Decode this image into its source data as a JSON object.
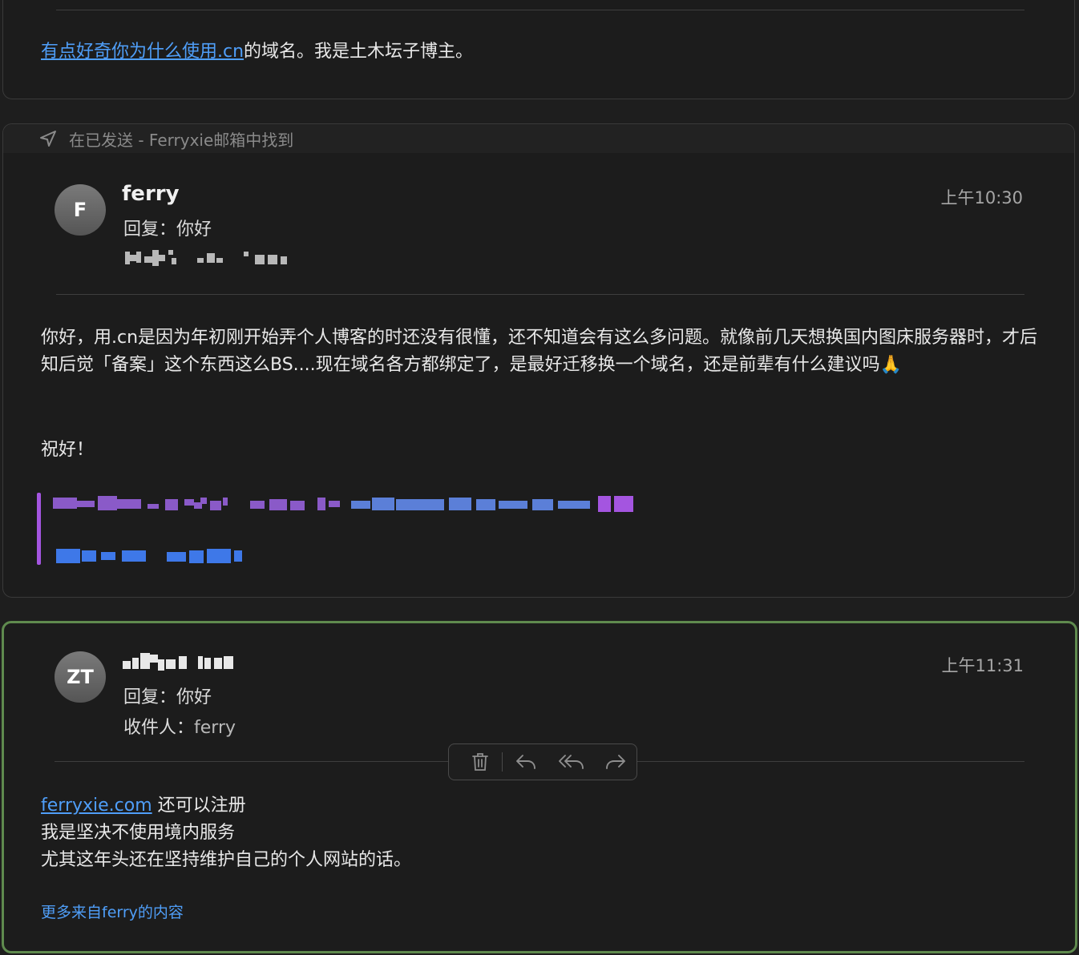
{
  "message1": {
    "body_link": "有点好奇你为什么使用.cn",
    "body_rest": "的域名。我是土木坛子博主。"
  },
  "message2": {
    "found_in": "在已发送 - Ferryxie邮箱中找到",
    "avatar_initial": "F",
    "sender": "ferry",
    "subject": "回复：你好",
    "time": "上午10:30",
    "body_p1": "你好，用.cn是因为年初刚开始弄个人博客的时还没有很懂，还不知道会有这么多问题。就像前几天想换国内图床服务器时，才后知后觉「备案」这个东西这么BS....现在域名各方都绑定了，是最好迁移换一个域名，还是前辈有什么建议吗🙏",
    "body_p2": "祝好！"
  },
  "message3": {
    "avatar_initial": "ZT",
    "subject": "回复：你好",
    "recipient_label": "收件人：",
    "recipient": "ferry",
    "time": "上午11:31",
    "body_link": "ferryxie.com",
    "body_line1_rest": " 还可以注册",
    "body_line2": "我是坚决不使用境内服务",
    "body_line3": "尤其这年头还在坚持维护自己的个人网站的话。",
    "more_link": "更多来自ferry的内容"
  },
  "toolbar": {
    "icons": [
      "trash-icon",
      "reply-icon",
      "reply-all-icon",
      "forward-icon"
    ]
  },
  "colors": {
    "link": "#4f9ef8",
    "quote_bar": "#a455e0",
    "selected_border": "#5f8a4e"
  }
}
